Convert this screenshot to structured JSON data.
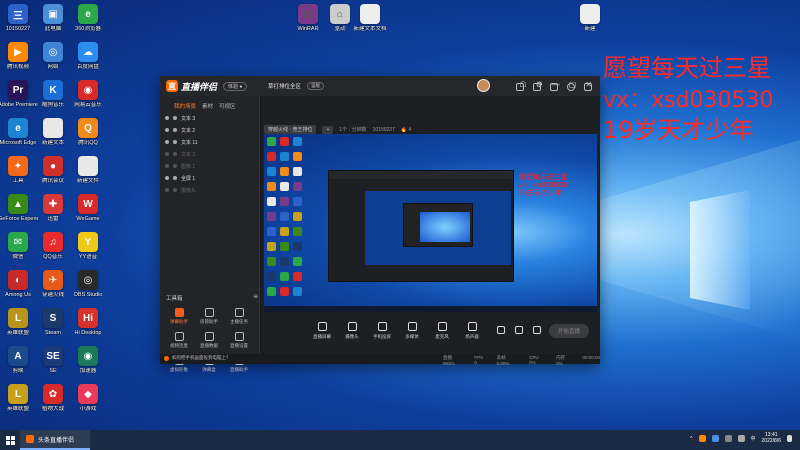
{
  "desktop": {
    "overlay_lines": [
      "愿望每天过三星",
      "vx：xsd030530",
      "19岁天才少年"
    ],
    "icons": [
      {
        "label": "10150227",
        "color": "#2a62c9",
        "glyph": "三"
      },
      {
        "label": "此电脑",
        "color": "#4b8fd8",
        "glyph": "▣"
      },
      {
        "label": "360浏览器",
        "color": "#2aa84a",
        "glyph": "e"
      },
      {
        "label": "腾讯视频",
        "color": "#ff8a00",
        "glyph": "▶"
      },
      {
        "label": "网络",
        "color": "#3f84d6",
        "glyph": "◎"
      },
      {
        "label": "百度网盘",
        "color": "#2d8cf0",
        "glyph": "☁"
      },
      {
        "label": "Adobe Premiere",
        "color": "#2a1458",
        "glyph": "Pr"
      },
      {
        "label": "酷狗音乐",
        "color": "#1a6ed8",
        "glyph": "K"
      },
      {
        "label": "网易云音乐",
        "color": "#d82a2a",
        "glyph": "◉"
      },
      {
        "label": "Microsoft Edge",
        "color": "#1d84d4",
        "glyph": "e"
      },
      {
        "label": "新建文本",
        "color": "#e8e8e8",
        "glyph": ""
      },
      {
        "label": "腾讯QQ",
        "color": "#f08a1a",
        "glyph": "Q"
      },
      {
        "label": "工具",
        "color": "#f06a1a",
        "glyph": "✦"
      },
      {
        "label": "腾讯会议",
        "color": "#d0302a",
        "glyph": "●"
      },
      {
        "label": "新建文件",
        "color": "#e8e8e8",
        "glyph": ""
      },
      {
        "label": "GeForce Experience",
        "color": "#3a8a1a",
        "glyph": "▲"
      },
      {
        "label": "迅雷",
        "color": "#d83a3a",
        "glyph": "✚"
      },
      {
        "label": "WeGame",
        "color": "#d82a2a",
        "glyph": "W"
      },
      {
        "label": "微信",
        "color": "#2aa84a",
        "glyph": "✉"
      },
      {
        "label": "QQ音乐",
        "color": "#e82a2a",
        "glyph": "♫"
      },
      {
        "label": "YY语音",
        "color": "#f0c81a",
        "glyph": "Y"
      },
      {
        "label": "Among Us",
        "color": "#c82a2a",
        "glyph": "◐"
      },
      {
        "label": "穿越火线",
        "color": "#e85a1a",
        "glyph": "✈"
      },
      {
        "label": "OBS Studio",
        "color": "#2a2a2a",
        "glyph": "◎"
      },
      {
        "label": "英雄联盟",
        "color": "#b8941a",
        "glyph": "L"
      },
      {
        "label": "Steam",
        "color": "#1a3a6a",
        "glyph": "S"
      },
      {
        "label": "Hi Desktop",
        "color": "#d8302a",
        "glyph": "Hi"
      },
      {
        "label": "剪映",
        "color": "#1a4a8a",
        "glyph": "A"
      },
      {
        "label": "SE",
        "color": "#1a3a7a",
        "glyph": "SE"
      },
      {
        "label": "加速器",
        "color": "#1a7a5a",
        "glyph": "◉"
      },
      {
        "label": "英雄联盟",
        "color": "#c8a01a",
        "glyph": "L"
      },
      {
        "label": "植物大战",
        "color": "#d82a2a",
        "glyph": "✿"
      },
      {
        "label": "小游戏",
        "color": "#e83a5a",
        "glyph": "◆"
      }
    ],
    "top_icons": [
      {
        "label": "WinRAR",
        "color": "#7a3a8a",
        "glyph": "▤"
      },
      {
        "label": "驱动",
        "color": "#cccccc",
        "glyph": "⌂"
      },
      {
        "label": "新建文本文档",
        "color": "#eeeeee",
        "glyph": ""
      },
      {
        "label": "新建",
        "color": "#eeeeee",
        "glyph": ""
      }
    ]
  },
  "app": {
    "name": "直播伴侣",
    "badge": "体验 ●",
    "window_controls": [
      "☖",
      "⚙",
      "—",
      "▢",
      "✕"
    ],
    "left_tabs": [
      "我的场景",
      "素材",
      "可视区"
    ],
    "layers": [
      {
        "name": "文本 3",
        "visible": true
      },
      {
        "name": "文本 2",
        "visible": true
      },
      {
        "name": "文本 11",
        "visible": true
      },
      {
        "name": "文本 3",
        "visible": false
      },
      {
        "name": "图像 1",
        "visible": false
      },
      {
        "name": "全屏 1",
        "visible": true
      },
      {
        "name": "摄像头",
        "visible": false
      }
    ],
    "tools_heading": "工具箱",
    "tools": [
      {
        "label": "弹幕助手",
        "hot": true
      },
      {
        "label": "房管助手",
        "hot": false
      },
      {
        "label": "主播任务",
        "hot": false
      },
      {
        "label": "视频连麦",
        "hot": false
      },
      {
        "label": "直播数据",
        "hot": false
      },
      {
        "label": "直播设置",
        "hot": false
      },
      {
        "label": "虚拟形象",
        "hot": false
      },
      {
        "label": "弹幕盒",
        "hot": false
      },
      {
        "label": "直播助手",
        "hot": false
      }
    ],
    "scene_title": "草打排位全区",
    "scene_pill": "竖版",
    "scene_tabs": [
      "穿越火线 · 竞王排位",
      "+"
    ],
    "scene_meta": [
      "1个 · 分钟数",
      "10150227",
      "4"
    ],
    "bottom_actions": [
      "直播屏幕",
      "摄像头",
      "手机投屏",
      "多媒体",
      "麦克风",
      "扬声器"
    ],
    "start_button": "开始直播",
    "tip": "如何把手机画面投到电脑上？",
    "stats": [
      "直播 0Kb/s",
      "FPS 0",
      "丢帧 0.00%",
      "CPU 0%",
      "内存 0%",
      "00:00:00"
    ]
  },
  "nested_overlay": [
    "愿望每天过三星",
    "vx：xsd030530",
    "19岁天才少年"
  ],
  "taskbar": {
    "item": "头条直播伴侣",
    "time": "13:41",
    "date": "2022/8/6",
    "tray": [
      "^",
      "中"
    ]
  }
}
